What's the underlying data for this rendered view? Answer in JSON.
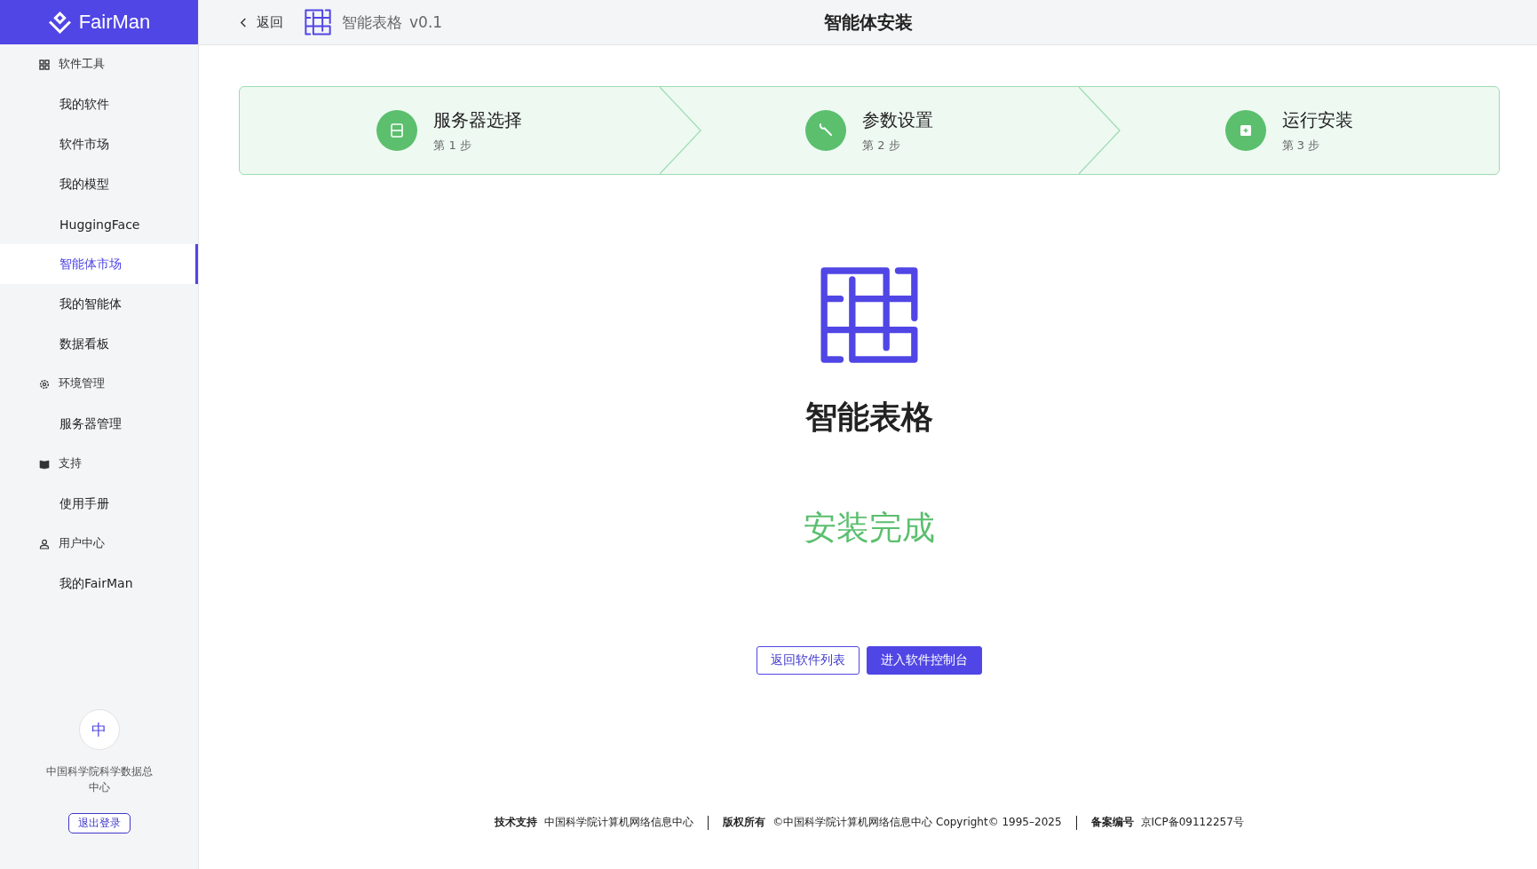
{
  "brand": {
    "name": "FairMan"
  },
  "header": {
    "back": "返回",
    "app_name": "智能表格",
    "version": "v0.1",
    "title": "智能体安装"
  },
  "sidebar": {
    "groups": [
      {
        "label": "软件工具",
        "items": [
          {
            "label": "我的软件",
            "selected": false
          },
          {
            "label": "软件市场",
            "selected": false
          },
          {
            "label": "我的模型",
            "selected": false
          },
          {
            "label": "HuggingFace",
            "selected": false
          },
          {
            "label": "智能体市场",
            "selected": true
          },
          {
            "label": "我的智能体",
            "selected": false
          },
          {
            "label": "数据看板",
            "selected": false
          }
        ]
      },
      {
        "label": "环境管理",
        "items": [
          {
            "label": "服务器管理",
            "selected": false
          }
        ]
      },
      {
        "label": "支持",
        "items": [
          {
            "label": "使用手册",
            "selected": false
          }
        ]
      },
      {
        "label": "用户中心",
        "items": [
          {
            "label": "我的FairMan",
            "selected": false
          }
        ]
      }
    ]
  },
  "user": {
    "avatar": "中",
    "org": "中国科学院科学数据总中心",
    "logout": "退出登录"
  },
  "steps": [
    {
      "title": "服务器选择",
      "subtitle": "第 1 步"
    },
    {
      "title": "参数设置",
      "subtitle": "第 2 步"
    },
    {
      "title": "运行安装",
      "subtitle": "第 3 步"
    }
  ],
  "result": {
    "app_name": "智能表格",
    "status": "安装完成"
  },
  "buttons": [
    {
      "label": "返回软件列表",
      "kind": "outline"
    },
    {
      "label": "进入软件控制台",
      "kind": "primary"
    }
  ],
  "footer": [
    {
      "label": "技术支持",
      "value": "中国科学院计算机网络信息中心"
    },
    {
      "label": "版权所有",
      "value": "©中国科学院计算机网络信息中心 Copyright© 1995–2025"
    },
    {
      "label": "备案编号",
      "value": "京ICP备09112257号"
    }
  ]
}
